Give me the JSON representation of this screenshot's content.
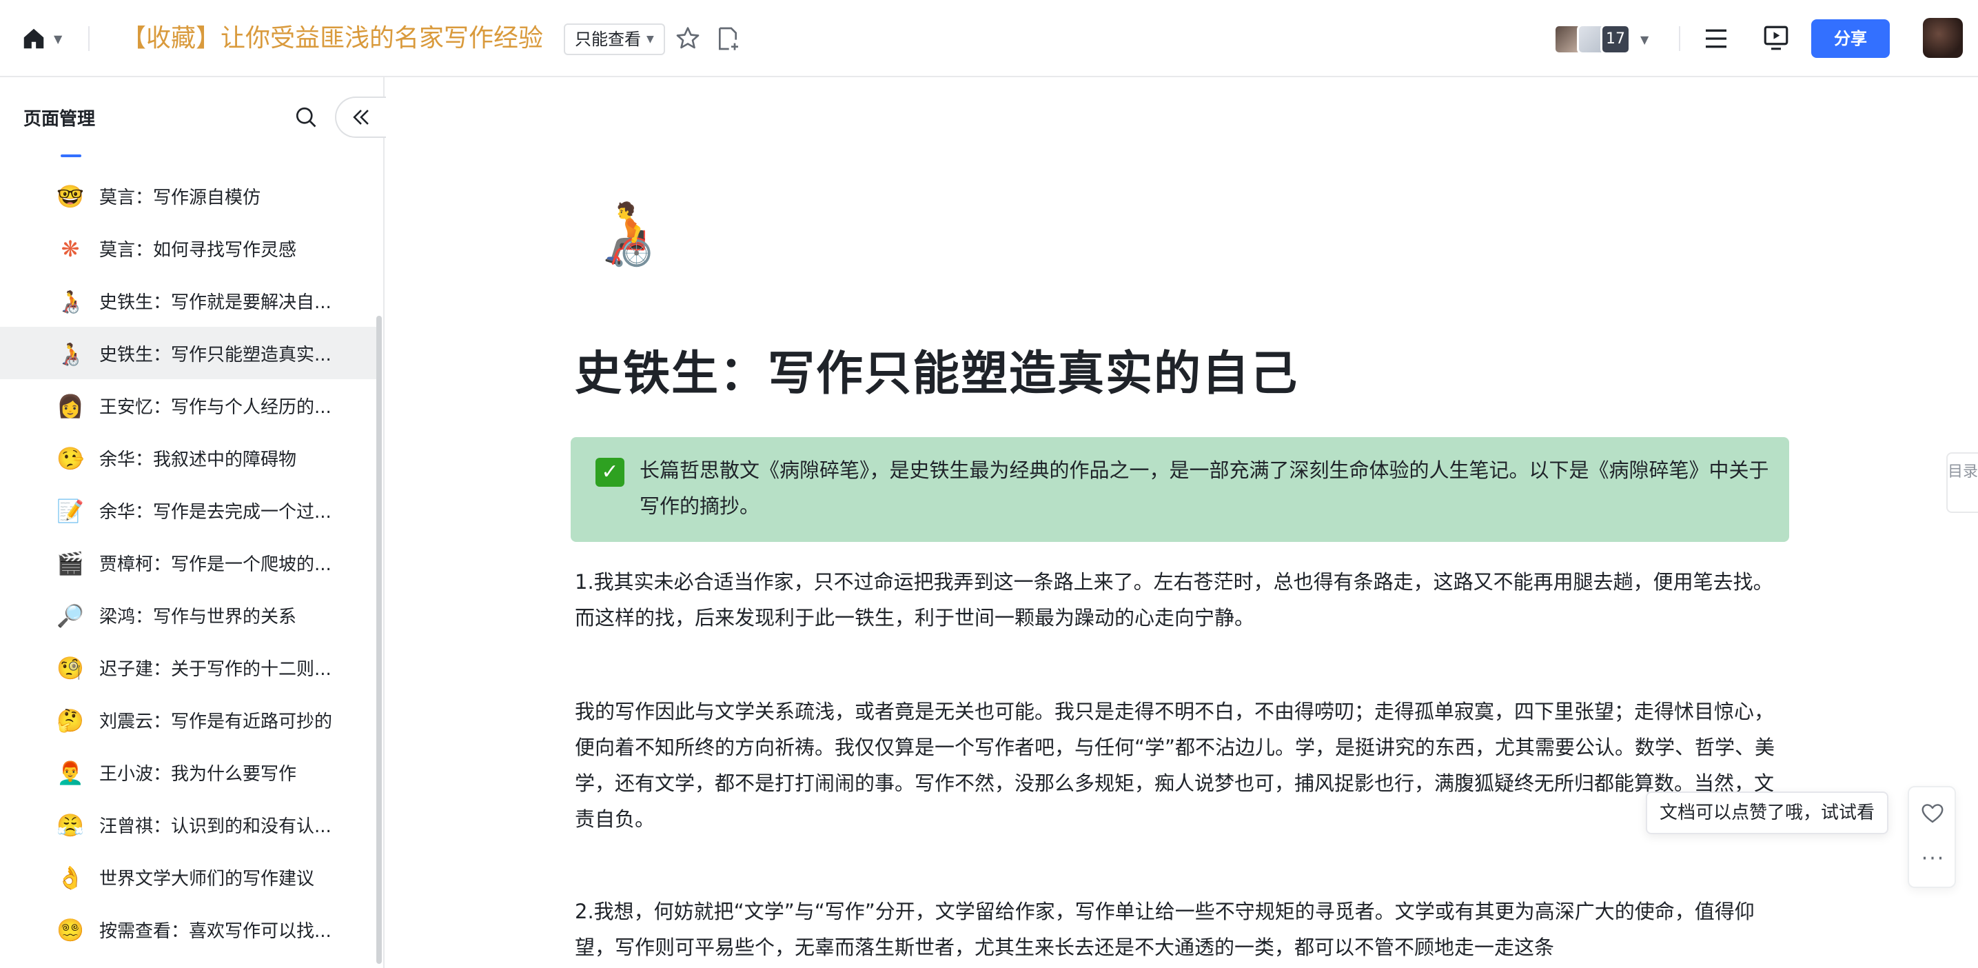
{
  "header": {
    "doc_title": "【收藏】让你受益匪浅的名家写作经验",
    "permission_label": "只能查看",
    "collaborator_count": "17",
    "share_label": "分享",
    "icons": [
      "home-icon",
      "star-icon",
      "add-page-icon",
      "menu-icon",
      "present-icon"
    ]
  },
  "sidebar": {
    "title": "页面管理",
    "items": [
      {
        "emoji": "🤓",
        "label": "莫言：写作源自模仿"
      },
      {
        "emoji": "❋",
        "label": "莫言：如何寻找写作灵感"
      },
      {
        "emoji": "🧑‍🦽",
        "label": "史铁生：写作就是要解决自..."
      },
      {
        "emoji": "🧑‍🦽",
        "label": "史铁生：写作只能塑造真实..."
      },
      {
        "emoji": "👩",
        "label": "王安忆：写作与个人经历的..."
      },
      {
        "emoji": "🤥",
        "label": "余华：我叙述中的障碍物"
      },
      {
        "emoji": "📝",
        "label": "余华：写作是去完成一个过..."
      },
      {
        "emoji": "🎬",
        "label": "贾樟柯：写作是一个爬坡的..."
      },
      {
        "emoji": "🔎",
        "label": "梁鸿：写作与世界的关系"
      },
      {
        "emoji": "🧐",
        "label": "迟子建：关于写作的十二则..."
      },
      {
        "emoji": "🤔",
        "label": "刘震云：写作是有近路可抄的"
      },
      {
        "emoji": "👨‍🦰",
        "label": "王小波：我为什么要写作"
      },
      {
        "emoji": "😤",
        "label": "汪曾祺：认识到的和没有认..."
      },
      {
        "emoji": "👌",
        "label": "世界文学大师们的写作建议"
      },
      {
        "emoji": "😵‍💫",
        "label": "按需查看：喜欢写作可以找..."
      }
    ],
    "active_index": 3
  },
  "doc": {
    "icon_emoji": "🧑‍🦽",
    "title": "史铁生：写作只能塑造真实的自己",
    "callout": "长篇哲思散文《病隙碎笔》，是史铁生最为经典的作品之一，是一部充满了深刻生命体验的人生笔记。以下是《病隙碎笔》中关于写作的摘抄。",
    "paragraphs": [
      "1.我其实未必合适当作家，只不过命运把我弄到这一条路上来了。左右苍茫时，总也得有条路走，这路又不能再用腿去趟，便用笔去找。而这样的找，后来发现利于此一铁生，利于世间一颗最为躁动的心走向宁静。",
      "我的写作因此与文学关系疏浅，或者竟是无关也可能。我只是走得不明不白，不由得唠叨；走得孤单寂寞，四下里张望；走得怵目惊心，便向着不知所终的方向祈祷。我仅仅算是一个写作者吧，与任何“学”都不沾边儿。学，是挺讲究的东西，尤其需要公认。数学、哲学、美学，还有文学，都不是打打闹闹的事。写作不然，没那么多规矩，痴人说梦也可，捕风捉影也行，满腹狐疑终无所归都能算数。当然，文责自负。",
      "2.我想，何妨就把“文学”与“写作”分开，文学留给作家，写作单让给一些不守规矩的寻觅者。文学或有其更为高深广大的使命，值得仰望，写作则可平易些个，无辜而落生斯世者，尤其生来长去还是不大通透的一类，都可以不管不顾地走一走这条"
    ]
  },
  "toc_label": "目录",
  "like_tip": "文档可以点赞了哦，试试看",
  "more_label": "···"
}
